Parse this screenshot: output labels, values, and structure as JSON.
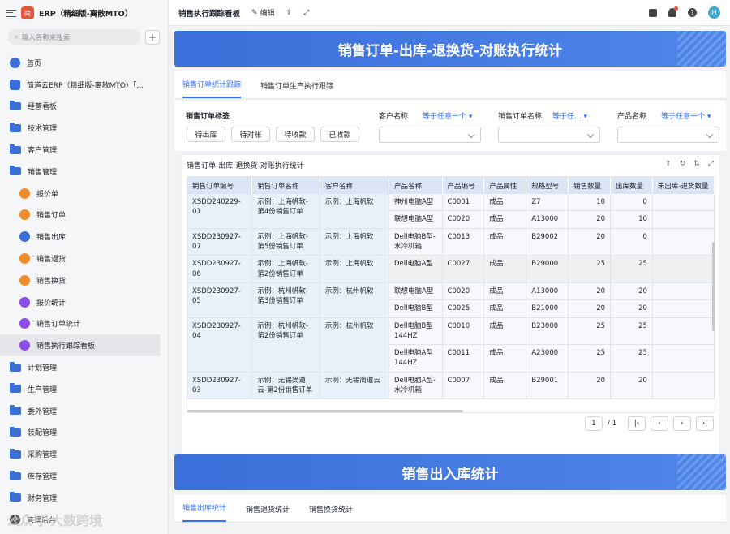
{
  "app": {
    "title": "ERP（精细版-离散MTO）",
    "logo": "简"
  },
  "sidebar": {
    "search_placeholder": "输入名称来搜索",
    "items": [
      {
        "label": "首页",
        "icon": "home-icon",
        "level": 0
      },
      {
        "label": "简道云ERP（精细版-离散MTO）「...",
        "icon": "document-icon",
        "level": 0
      },
      {
        "label": "经营看板",
        "icon": "folder-icon",
        "level": 0
      },
      {
        "label": "技术管理",
        "icon": "folder-icon",
        "level": 0
      },
      {
        "label": "客户管理",
        "icon": "folder-icon",
        "level": 0
      },
      {
        "label": "销售管理",
        "icon": "folder-open-icon",
        "level": 0
      },
      {
        "label": "报价单",
        "icon": "form-icon",
        "level": 1
      },
      {
        "label": "销售订单",
        "icon": "form-icon",
        "level": 1
      },
      {
        "label": "销售出库",
        "icon": "form-icon",
        "level": 1
      },
      {
        "label": "销售退货",
        "icon": "form-icon",
        "level": 1
      },
      {
        "label": "销售换货",
        "icon": "form-icon",
        "level": 1
      },
      {
        "label": "报价统计",
        "icon": "chart-icon",
        "level": 1
      },
      {
        "label": "销售订单统计",
        "icon": "chart-icon",
        "level": 1
      },
      {
        "label": "销售执行跟踪看板",
        "icon": "chart-icon",
        "level": 1,
        "active": true
      },
      {
        "label": "计划管理",
        "icon": "folder-icon",
        "level": 0
      },
      {
        "label": "生产管理",
        "icon": "folder-icon",
        "level": 0
      },
      {
        "label": "委外管理",
        "icon": "folder-icon",
        "level": 0
      },
      {
        "label": "装配管理",
        "icon": "folder-icon",
        "level": 0
      },
      {
        "label": "采购管理",
        "icon": "folder-icon",
        "level": 0
      },
      {
        "label": "库存管理",
        "icon": "folder-icon",
        "level": 0
      },
      {
        "label": "财务管理",
        "icon": "folder-icon",
        "level": 0
      }
    ],
    "bottom": "管理后台",
    "watermark": "公众号·大数跨境"
  },
  "topbar": {
    "title": "销售执行跟踪看板",
    "edit_label": "编辑",
    "avatar": "H"
  },
  "banner1": "销售订单-出库-退换货-对账执行统计",
  "tabs1": [
    "销售订单统计跟踪",
    "销售订单生产执行跟踪"
  ],
  "filters": {
    "tag_label": "销售订单标签",
    "tags": [
      "待出库",
      "待对账",
      "待收款",
      "已收款"
    ],
    "customer_label": "客户名称",
    "customer_op": "等于任意一个",
    "order_label": "销售订单名称",
    "order_op": "等于任...",
    "product_label": "产品名称",
    "product_op": "等于任意一个"
  },
  "table": {
    "title": "销售订单-出库-退换货-对账执行统计",
    "columns": [
      "销售订单编号",
      "销售订单名称",
      "客户名称",
      "产品名称",
      "产品编号",
      "产品属性",
      "规格型号",
      "销售数量",
      "出库数量",
      "未出库-退货数量"
    ],
    "groups": [
      {
        "code": "XSDD240229-01",
        "name": "示例：上海帆软-第4份销售订单",
        "customer": "示例：上海帆软",
        "rows": [
          {
            "product": "神州电脑A型",
            "pcode": "C0001",
            "attr": "成品",
            "spec": "Z7",
            "qty": "10",
            "out": "0"
          },
          {
            "product": "联想电脑A型",
            "pcode": "C0020",
            "attr": "成品",
            "spec": "A13000",
            "qty": "20",
            "out": "10"
          }
        ]
      },
      {
        "code": "XSDD230927-07",
        "name": "示例：上海帆软-第5份销售订单",
        "customer": "示例：上海帆软",
        "rows": [
          {
            "product": "Dell电脑B型-水冷机箱",
            "pcode": "C0013",
            "attr": "成品",
            "spec": "B29002",
            "qty": "20",
            "out": "0"
          }
        ]
      },
      {
        "code": "XSDD230927-06",
        "name": "示例：上海帆软-第2份销售订单",
        "customer": "示例：上海帆软",
        "rows": [
          {
            "product": "Dell电脑A型",
            "pcode": "C0027",
            "attr": "成品",
            "spec": "B29000",
            "qty": "25",
            "out": "25"
          }
        ]
      },
      {
        "code": "XSDD230927-05",
        "name": "示例：杭州帆软-第3份销售订单",
        "customer": "示例：杭州帆软",
        "rows": [
          {
            "product": "联想电脑A型",
            "pcode": "C0020",
            "attr": "成品",
            "spec": "A13000",
            "qty": "20",
            "out": "20"
          },
          {
            "product": "Dell电脑B型",
            "pcode": "C0025",
            "attr": "成品",
            "spec": "B21000",
            "qty": "20",
            "out": "20"
          }
        ]
      },
      {
        "code": "XSDD230927-04",
        "name": "示例：杭州帆软-第2份销售订单",
        "customer": "示例：杭州帆软",
        "rows": [
          {
            "product": "Dell电脑B型 144HZ",
            "pcode": "C0010",
            "attr": "成品",
            "spec": "B23000",
            "qty": "25",
            "out": "25"
          },
          {
            "product": "Dell电脑A型 144HZ",
            "pcode": "C0011",
            "attr": "成品",
            "spec": "A23000",
            "qty": "25",
            "out": "25"
          }
        ]
      },
      {
        "code": "XSDD230927-03",
        "name": "示例：无锡简道云-第2份销售订单",
        "customer": "示例：无锡简道云",
        "rows": [
          {
            "product": "Dell电脑A型-水冷机箱",
            "pcode": "C0007",
            "attr": "成品",
            "spec": "B29001",
            "qty": "20",
            "out": "20"
          }
        ]
      }
    ]
  },
  "pager": {
    "page": "1",
    "total": "/ 1"
  },
  "banner2": "销售出入库统计",
  "tabs2": [
    "销售出库统计",
    "销售退货统计",
    "销售换货统计"
  ]
}
